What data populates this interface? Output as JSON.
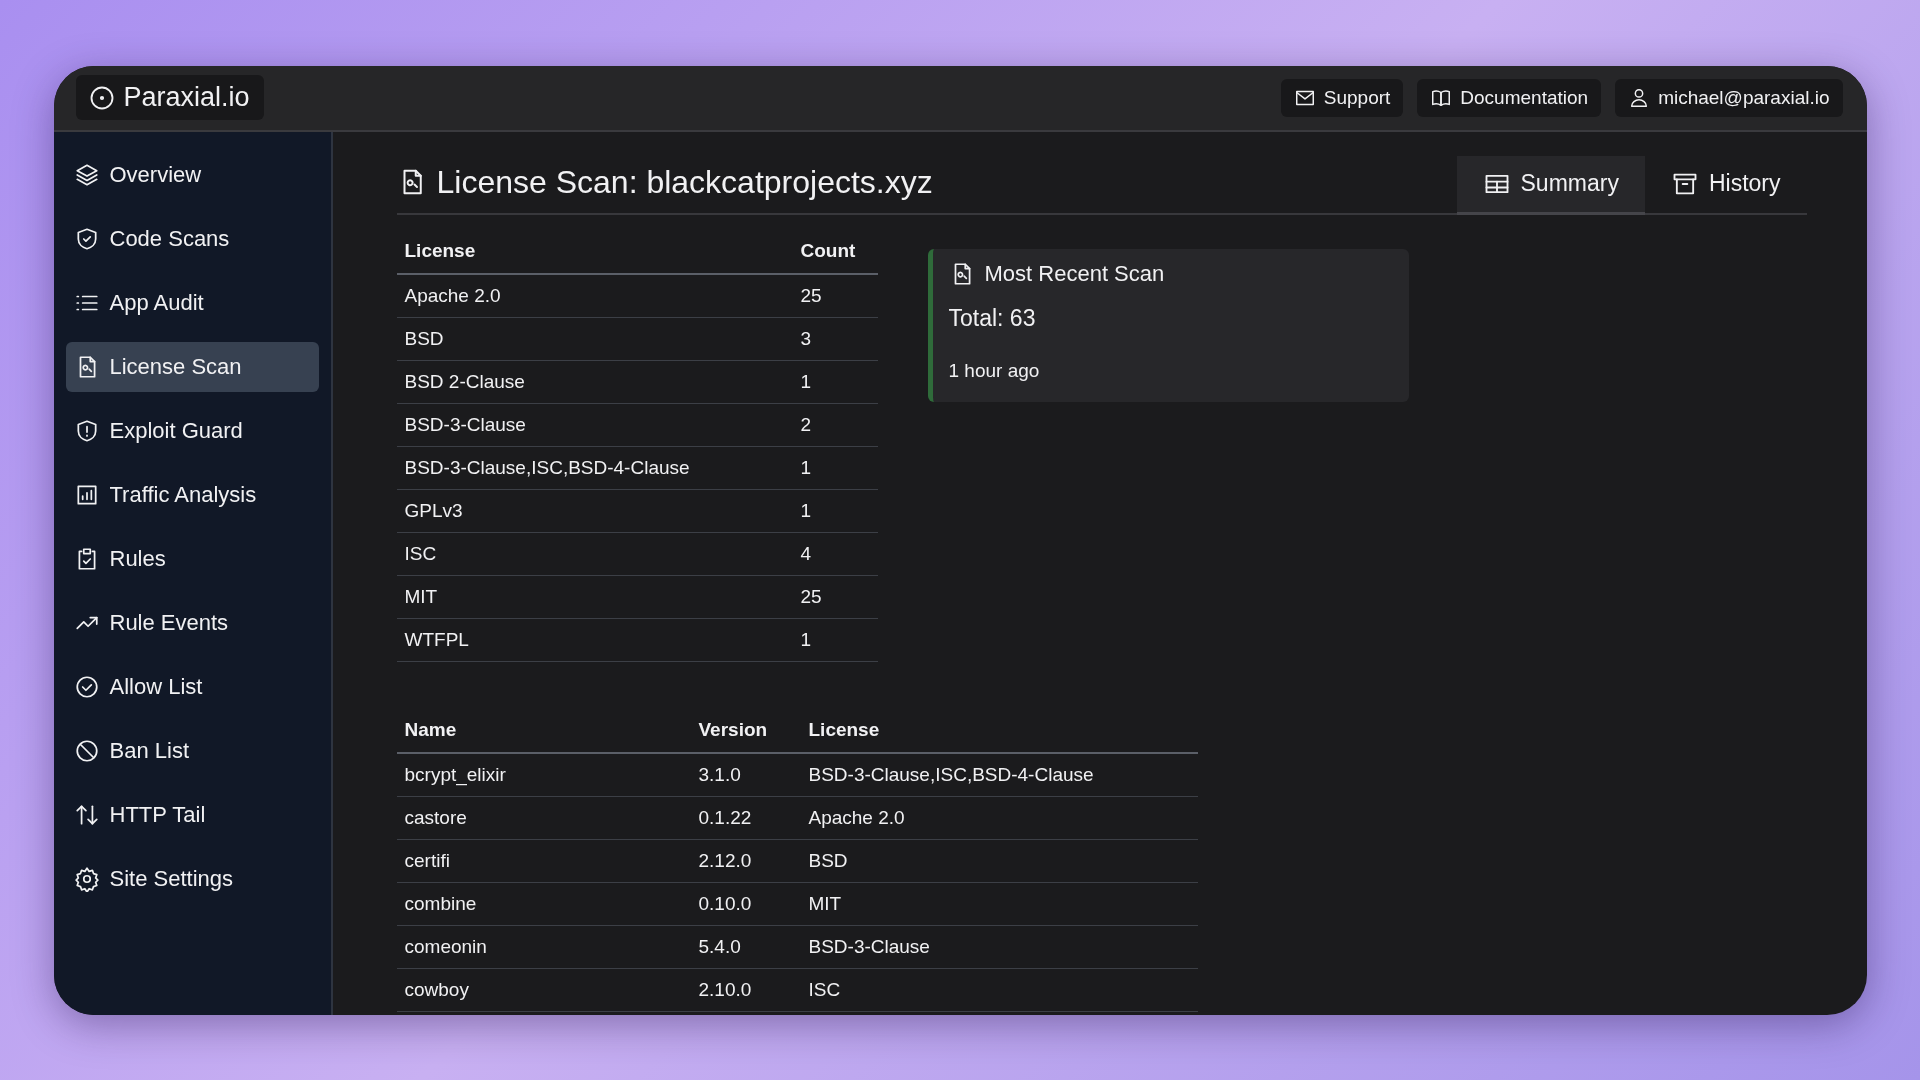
{
  "brand": "Paraxial.io",
  "top_links": [
    {
      "label": "Support"
    },
    {
      "label": "Documentation"
    },
    {
      "label": "michael@paraxial.io"
    }
  ],
  "sidebar": {
    "items": [
      {
        "label": "Overview",
        "selected": false
      },
      {
        "label": "Code Scans",
        "selected": false
      },
      {
        "label": "App Audit",
        "selected": false
      },
      {
        "label": "License Scan",
        "selected": true
      },
      {
        "label": "Exploit Guard",
        "selected": false
      },
      {
        "label": "Traffic Analysis",
        "selected": false
      },
      {
        "label": "Rules",
        "selected": false
      },
      {
        "label": "Rule Events",
        "selected": false
      },
      {
        "label": "Allow List",
        "selected": false
      },
      {
        "label": "Ban List",
        "selected": false
      },
      {
        "label": "HTTP Tail",
        "selected": false
      },
      {
        "label": "Site Settings",
        "selected": false
      }
    ]
  },
  "title": "License Scan: blackcatprojects.xyz",
  "tabs": [
    {
      "label": "Summary",
      "selected": true
    },
    {
      "label": "History",
      "selected": false
    }
  ],
  "license_table": {
    "columns": [
      "License",
      "Count"
    ],
    "rows": [
      [
        "Apache 2.0",
        "25"
      ],
      [
        "BSD",
        "3"
      ],
      [
        "BSD 2-Clause",
        "1"
      ],
      [
        "BSD-3-Clause",
        "2"
      ],
      [
        "BSD-3-Clause,ISC,BSD-4-Clause",
        "1"
      ],
      [
        "GPLv3",
        "1"
      ],
      [
        "ISC",
        "4"
      ],
      [
        "MIT",
        "25"
      ],
      [
        "WTFPL",
        "1"
      ]
    ]
  },
  "card": {
    "title": "Most Recent Scan",
    "total": "Total: 63",
    "time": "1 hour ago"
  },
  "dependency_table": {
    "columns": [
      "Name",
      "Version",
      "License"
    ],
    "rows": [
      [
        "bcrypt_elixir",
        "3.1.0",
        "BSD-3-Clause,ISC,BSD-4-Clause"
      ],
      [
        "castore",
        "0.1.22",
        "Apache 2.0"
      ],
      [
        "certifi",
        "2.12.0",
        "BSD"
      ],
      [
        "combine",
        "0.10.0",
        "MIT"
      ],
      [
        "comeonin",
        "5.4.0",
        "BSD-3-Clause"
      ],
      [
        "cowboy",
        "2.10.0",
        "ISC"
      ]
    ]
  }
}
